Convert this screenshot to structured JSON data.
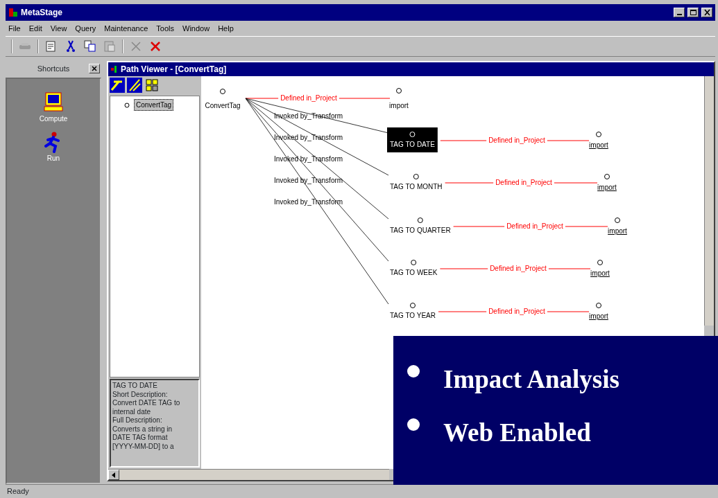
{
  "window": {
    "title": "MetaStage"
  },
  "menu": [
    "File",
    "Edit",
    "View",
    "Query",
    "Maintenance",
    "Tools",
    "Window",
    "Help"
  ],
  "shortcuts": {
    "title": "Shortcuts",
    "items": [
      {
        "kind": "computer",
        "label": "Compute"
      },
      {
        "kind": "runner",
        "label": "Run"
      }
    ]
  },
  "child_window": {
    "title": "Path Viewer - [ConvertTag]"
  },
  "tree": [
    {
      "label": "ConvertTag",
      "selected": true
    }
  ],
  "description": [
    "TAG TO DATE",
    "Short Description:",
    "Convert DATE TAG to",
    "internal date",
    "Full Description:",
    "Converts a string in",
    "DATE TAG format",
    "[YYYY-MM-DD] to a"
  ],
  "diagram": {
    "root": {
      "label": "ConvertTag",
      "link_label": "Defined in_Project",
      "target": "import"
    },
    "children": [
      {
        "edge_label": "Invoked by_Transform",
        "label": "TAG TO DATE",
        "selected": true,
        "link_label": "Defined in_Project",
        "target": "import"
      },
      {
        "edge_label": "Invoked by_Transform",
        "label": "TAG TO MONTH",
        "selected": false,
        "link_label": "Defined in_Project",
        "target": "import"
      },
      {
        "edge_label": "Invoked by_Transform",
        "label": "TAG TO QUARTER",
        "selected": false,
        "link_label": "Defined in_Project",
        "target": "import"
      },
      {
        "edge_label": "Invoked by_Transform",
        "label": "TAG TO WEEK",
        "selected": false,
        "link_label": "Defined in_Project",
        "target": "import"
      },
      {
        "edge_label": "Invoked by_Transform",
        "label": "TAG TO YEAR",
        "selected": false,
        "link_label": "Defined in_Project",
        "target": "import"
      }
    ]
  },
  "status_bar": "Ready",
  "overlay": {
    "bullets": [
      "Impact Analysis",
      "Web Enabled"
    ]
  }
}
